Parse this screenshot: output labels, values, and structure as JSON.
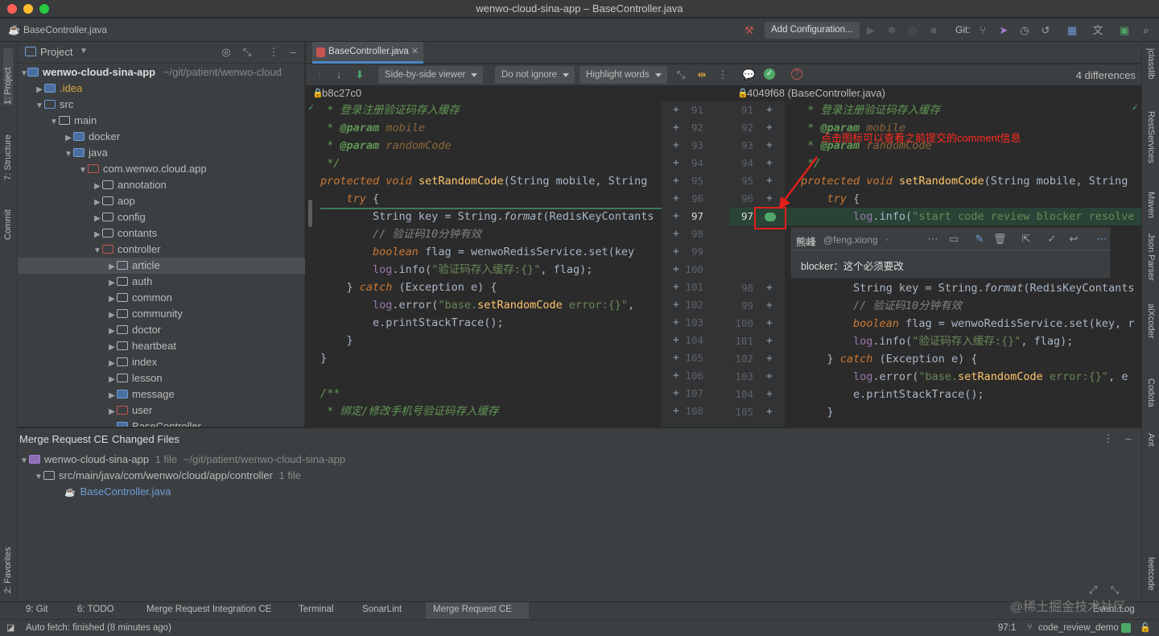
{
  "window": {
    "title": "wenwo-cloud-sina-app – BaseController.java"
  },
  "nav": {
    "file": "BaseController.java",
    "add_config": "Add Configuration...",
    "git_label": "Git:"
  },
  "project": {
    "header": "Project",
    "root_name": "wenwo-cloud-sina-app",
    "root_path": "~/git/patient/wenwo-cloud",
    "items": [
      ".idea",
      "src",
      "main",
      "docker",
      "java",
      "com.wenwo.cloud.app",
      "annotation",
      "aop",
      "config",
      "contants",
      "controller",
      "article",
      "auth",
      "common",
      "community",
      "doctor",
      "heartbeat",
      "index",
      "lesson",
      "message",
      "user",
      "BaseController"
    ]
  },
  "editor": {
    "tab_label": "BaseController.java",
    "viewer_mode": "Side-by-side viewer",
    "ignore_mode": "Do not ignore",
    "highlight_mode": "Highlight words",
    "differences": "4 differences",
    "left_rev": "b8c27c0",
    "right_rev": "4049f68 (BaseController.java)"
  },
  "left_code": [
    " * 登录注册验证码存入缓存",
    " * @param mobile",
    " * @param randomCode",
    " */",
    "protected void setRandomCode(String mobile, String",
    "    try {",
    "        String key = String.format(RedisKeyContants",
    "        // 验证码10分钟有效",
    "        boolean flag = wenwoRedisService.set(key",
    "        log.info(\"验证码存入缓存:{}\", flag);",
    "    } catch (Exception e) {",
    "        log.error(\"base.setRandomCode error:{}\",",
    "        e.printStackTrace();",
    "    }",
    "}",
    "",
    "/**",
    " * 绑定/修改手机号验证码存入缓存"
  ],
  "left_lines": [
    "91",
    "92",
    "93",
    "94",
    "95",
    "96",
    "97",
    "98",
    "99",
    "100",
    "101",
    "102",
    "103",
    "104",
    "105",
    "106",
    "107",
    "108"
  ],
  "right_lines": [
    "91",
    "92",
    "93",
    "94",
    "95",
    "96",
    "97",
    "98",
    "99",
    "100",
    "101",
    "102",
    "103",
    "104",
    "105"
  ],
  "right_code": [
    " * 登录注册验证码存入缓存",
    " * @param mobile",
    " * @param randomCode",
    " */",
    "protected void setRandomCode(String mobile, String",
    "    try {",
    "        log.info(\"start code review blocker resolve",
    "        String key = String.format(RedisKeyContants",
    "        // 验证码10分钟有效",
    "        boolean flag = wenwoRedisService.set(key, r",
    "        log.info(\"验证码存入缓存:{}\", flag);",
    "    } catch (Exception e) {",
    "        log.error(\"base.setRandomCode error:{}\", e",
    "        e.printStackTrace();",
    "    }"
  ],
  "annotation": "点击图标可以查看之前提交的comment信息",
  "comment": {
    "author": "熊峰",
    "handle": "@feng.xiong",
    "sep": "·",
    "body": "blocker：这个必须要改"
  },
  "bottom": {
    "tab1": "Merge Request CE",
    "tab2": "Changed Files",
    "repo": "wenwo-cloud-sina-app",
    "repo_count": "1 file",
    "repo_path": "~/git/patient/wenwo-cloud-sina-app",
    "dir": "src/main/java/com/wenwo/cloud/app/controller",
    "dir_count": "1 file",
    "file": "BaseController.java"
  },
  "toolwindows": [
    "9: Git",
    "6: TODO",
    "Merge Request Integration CE",
    "Terminal",
    "SonarLint",
    "Merge Request CE"
  ],
  "event_log": "Event Log",
  "watermark": "@稀土掘金技术社区",
  "status": {
    "message": "Auto fetch: finished (8 minutes ago)",
    "position": "97:1",
    "branch": "code_review_demo"
  },
  "left_tabs": [
    "1: Project",
    "7: Structure",
    "Commit",
    "2: Favorites"
  ],
  "right_tabs": [
    "jclasslib",
    "RestServices",
    "Maven",
    "Json Parser",
    "aiXcoder",
    "Codota",
    "Ant",
    "leetcode"
  ]
}
